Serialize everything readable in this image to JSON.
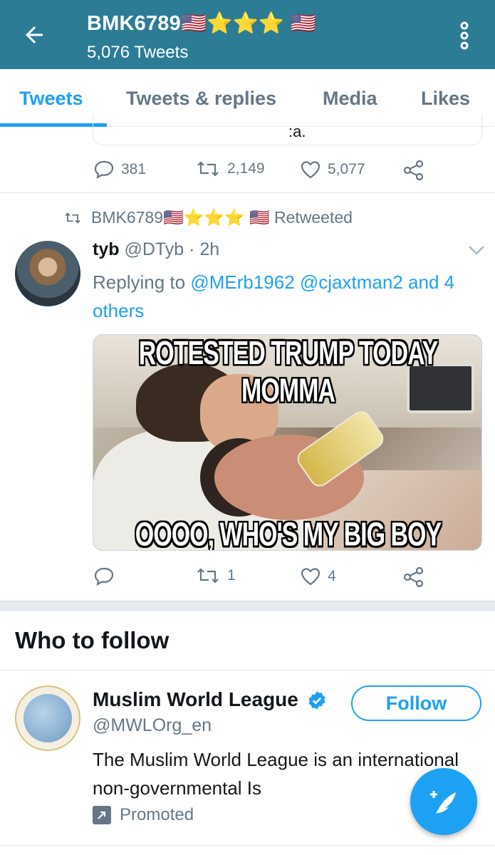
{
  "header": {
    "title": "BMK6789🇺🇸⭐⭐⭐ 🇺🇸",
    "subtitle": "5,076 Tweets",
    "bg_color": "#2c7c96",
    "back_icon": "arrow-left-icon",
    "menu_icon": "kebab-menu-icon"
  },
  "tabs": [
    {
      "label": "Tweets",
      "active": true
    },
    {
      "label": "Tweets & replies",
      "active": false
    },
    {
      "label": "Media",
      "active": false
    },
    {
      "label": "Likes",
      "active": false
    }
  ],
  "prev_tweet": {
    "quote_text_fragment": ":a.",
    "replies": "381",
    "retweets": "2,149",
    "likes": "5,077"
  },
  "retweet": {
    "context": "BMK6789🇺🇸⭐⭐⭐ 🇺🇸 Retweeted",
    "name": "tyb",
    "handle": "@DTyb · 2h",
    "replying_prefix": "Replying to ",
    "mention_1": "@MErb1962",
    "mention_2": "@cjaxtman2",
    "mention_3": "and 4 others",
    "meme_top": "ROTESTED TRUMP TODAY MOMMA",
    "meme_bottom": "OOOO, WHO'S MY BIG BOY",
    "replies": "",
    "retweets": "1",
    "likes": "4"
  },
  "who_to_follow": {
    "title": "Who to follow",
    "account": {
      "name": "Muslim World League",
      "handle": "@MWLOrg_en",
      "bio": "The Muslim World League is an international non-governmental Is",
      "promoted": "Promoted",
      "follow_label": "Follow"
    }
  },
  "colors": {
    "accent": "#1da1f2",
    "muted": "#657786",
    "text": "#14171a"
  }
}
